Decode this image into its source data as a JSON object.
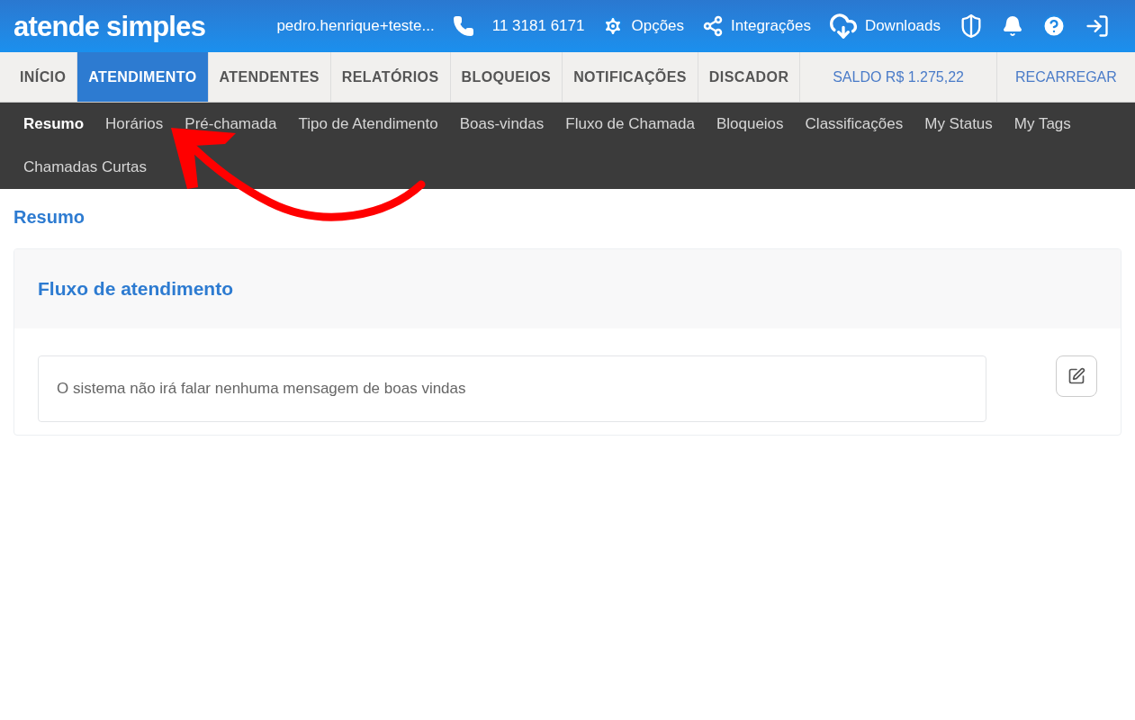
{
  "header": {
    "logo": "atende simples",
    "user": "pedro.henrique+teste...",
    "phone": "11 3181 6171",
    "links": [
      {
        "kind": "options",
        "label": "Opções"
      },
      {
        "kind": "integrations",
        "label": "Integrações"
      },
      {
        "kind": "downloads",
        "label": "Downloads"
      }
    ]
  },
  "main_nav": {
    "tabs": [
      {
        "label": "INÍCIO",
        "selected": false
      },
      {
        "label": "ATENDIMENTO",
        "selected": true
      },
      {
        "label": "ATENDENTES",
        "selected": false
      },
      {
        "label": "RELATÓRIOS",
        "selected": false
      },
      {
        "label": "BLOQUEIOS",
        "selected": false
      },
      {
        "label": "NOTIFICAÇÕES",
        "selected": false
      },
      {
        "label": "DISCADOR",
        "selected": false
      }
    ],
    "balance": "SALDO R$ 1.275,22",
    "recharge": "RECARREGAR"
  },
  "sub_nav": {
    "items": [
      {
        "label": "Resumo",
        "selected": true
      },
      {
        "label": "Horários",
        "selected": false
      },
      {
        "label": "Pré-chamada",
        "selected": false
      },
      {
        "label": "Tipo de Atendimento",
        "selected": false
      },
      {
        "label": "Boas-vindas",
        "selected": false
      },
      {
        "label": "Fluxo de Chamada",
        "selected": false
      },
      {
        "label": "Bloqueios",
        "selected": false
      },
      {
        "label": "Classificações",
        "selected": false
      },
      {
        "label": "My Status",
        "selected": false
      },
      {
        "label": "My Tags",
        "selected": false
      },
      {
        "label": "Chamadas Curtas",
        "selected": false
      }
    ]
  },
  "page": {
    "title": "Resumo",
    "card": {
      "title": "Fluxo de atendimento",
      "message": "O sistema não irá falar nenhuma mensagem de boas vindas"
    }
  }
}
